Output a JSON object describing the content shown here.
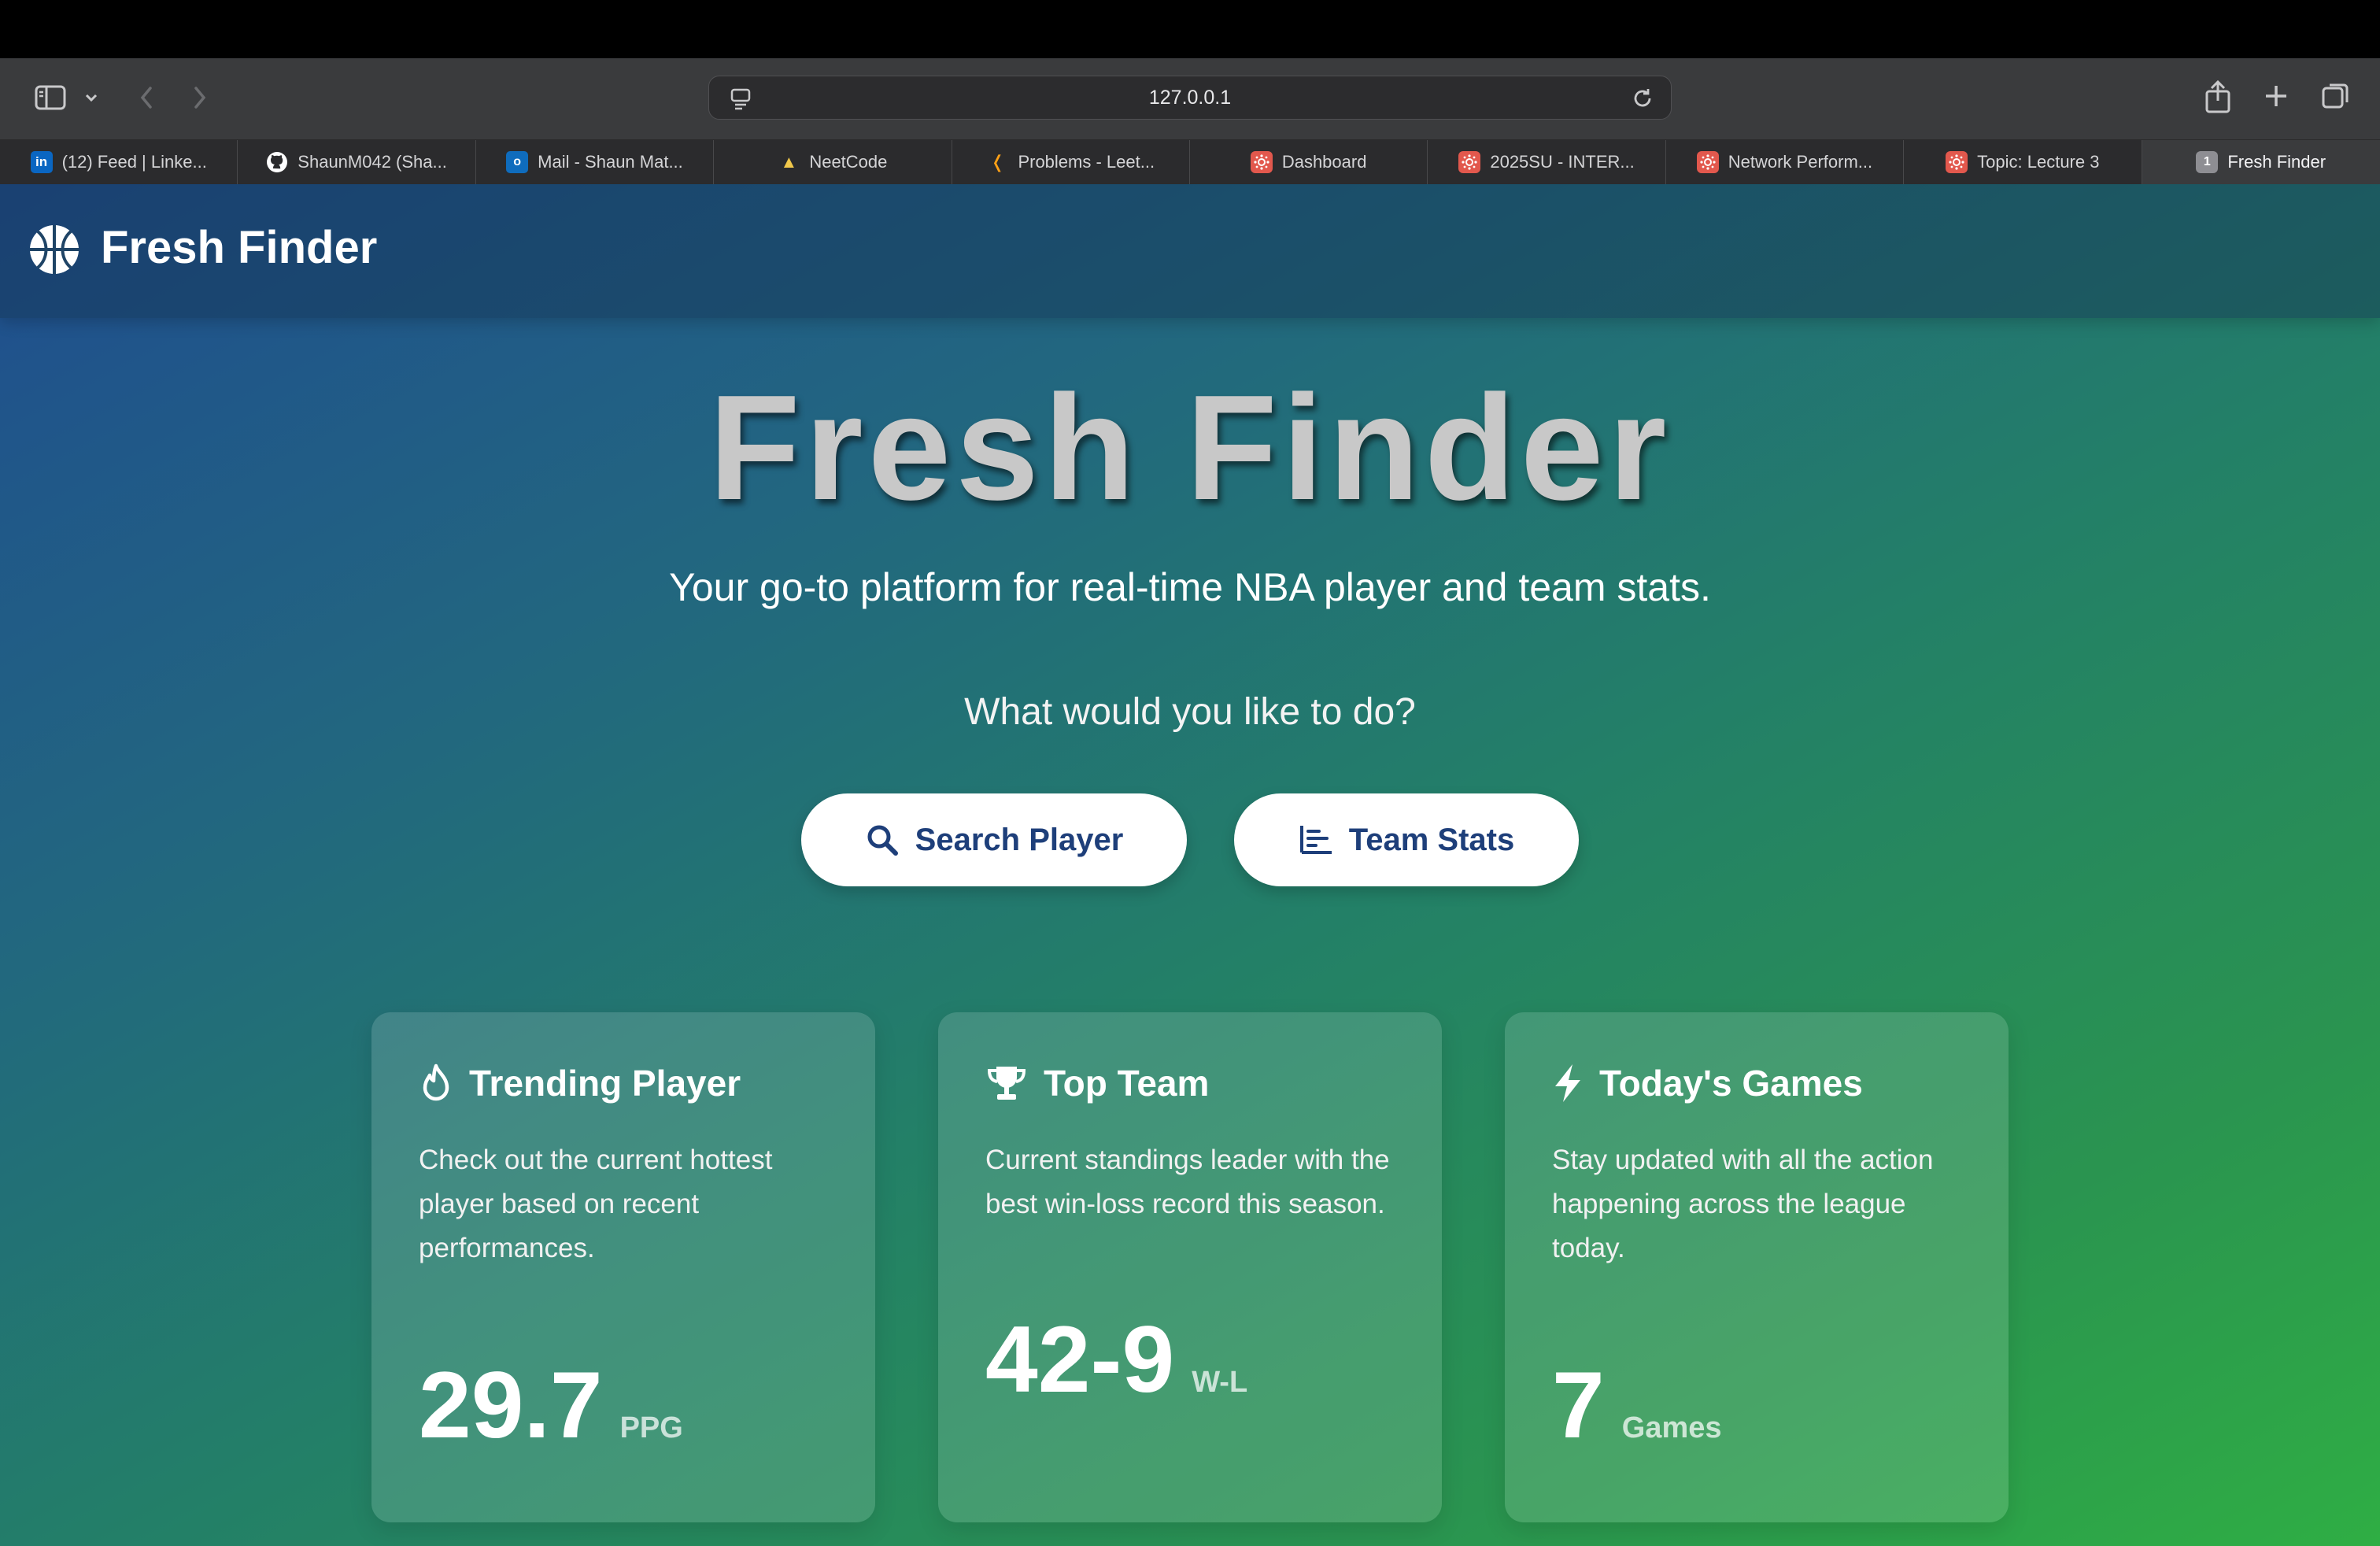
{
  "browser": {
    "url": "127.0.0.1",
    "tabs": [
      {
        "label": "(12) Feed | Linke...",
        "icon": "linkedin-icon",
        "badge": "in"
      },
      {
        "label": "ShaunM042 (Sha...",
        "icon": "github-icon",
        "badge": ""
      },
      {
        "label": "Mail - Shaun Mat...",
        "icon": "outlook-icon",
        "badge": "o"
      },
      {
        "label": "NeetCode",
        "icon": "rocket-icon",
        "badge": ""
      },
      {
        "label": "Problems - Leet...",
        "icon": "leetcode-icon",
        "badge": ""
      },
      {
        "label": "Dashboard",
        "icon": "canvas-icon",
        "badge": ""
      },
      {
        "label": "2025SU - INTER...",
        "icon": "canvas-icon",
        "badge": ""
      },
      {
        "label": "Network Perform...",
        "icon": "canvas-icon",
        "badge": ""
      },
      {
        "label": "Topic: Lecture 3",
        "icon": "canvas-icon",
        "badge": ""
      },
      {
        "label": "Fresh Finder",
        "icon": "tab-number-icon",
        "badge": "1"
      }
    ]
  },
  "nav": {
    "brand": "Fresh Finder",
    "brand_icon": "basketball-icon"
  },
  "hero": {
    "title": "Fresh Finder",
    "subtitle": "Your go-to platform for real-time NBA player and team stats.",
    "question": "What would you like to do?",
    "buttons": {
      "search_player": "Search Player",
      "team_stats": "Team Stats"
    }
  },
  "cards": [
    {
      "icon": "fire-icon",
      "title": "Trending Player",
      "description": "Check out the current hottest player based on recent performances.",
      "stat": "29.7",
      "unit": "PPG"
    },
    {
      "icon": "trophy-icon",
      "title": "Top Team",
      "description": "Current standings leader with the best win-loss record this season.",
      "stat": "42-9",
      "unit": "W-L"
    },
    {
      "icon": "bolt-icon",
      "title": "Today's Games",
      "description": "Stay updated with all the action happening across the league today.",
      "stat": "7",
      "unit": "Games"
    }
  ],
  "colors": {
    "button_text": "#1e3f7a",
    "gradient_start": "#1f4d8f",
    "gradient_end": "#2fae44"
  }
}
